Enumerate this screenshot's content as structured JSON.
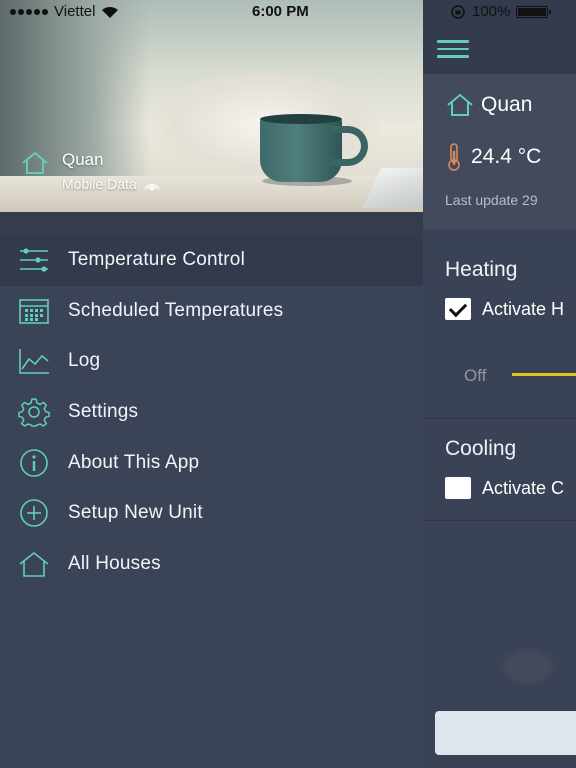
{
  "status_bar": {
    "carrier": "Viettel",
    "time": "6:00 PM",
    "battery": "100%"
  },
  "drawer": {
    "header": {
      "house_name": "Quan",
      "connection": "Mobile Data"
    },
    "menu": [
      {
        "label": "Temperature Control",
        "icon": "sliders-icon",
        "active": true
      },
      {
        "label": "Scheduled Temperatures",
        "icon": "calendar-icon",
        "active": false
      },
      {
        "label": "Log",
        "icon": "line-chart-icon",
        "active": false
      },
      {
        "label": "Settings",
        "icon": "gear-icon",
        "active": false
      },
      {
        "label": "About This App",
        "icon": "info-icon",
        "active": false
      },
      {
        "label": "Setup New Unit",
        "icon": "plus-circle-icon",
        "active": false
      },
      {
        "label": "All Houses",
        "icon": "house-icon",
        "active": false
      }
    ]
  },
  "main": {
    "house_name": "Quan",
    "temperature": "24.4 °C",
    "last_update": "Last update 29",
    "heating": {
      "title": "Heating",
      "activate_label": "Activate H",
      "checked": true,
      "slider_off_label": "Off"
    },
    "cooling": {
      "title": "Cooling",
      "activate_label": "Activate C",
      "checked": false
    }
  },
  "colors": {
    "accent": "#5fcfb8",
    "background": "#3a4255",
    "slider": "#e6c21a"
  }
}
